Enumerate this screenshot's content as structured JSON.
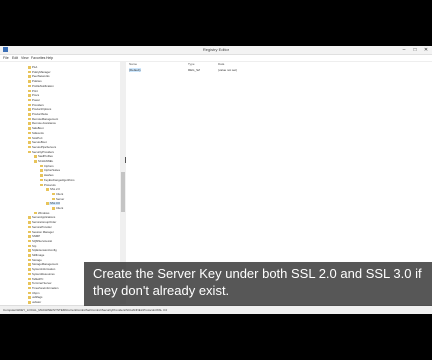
{
  "window": {
    "title": "Registry Editor",
    "controls": [
      "–",
      "□",
      "✕"
    ]
  },
  "menu": [
    "File",
    "Edit",
    "View",
    "Favorites",
    "Help"
  ],
  "tree": {
    "items": [
      "PLA",
      "PolicyManager",
      "PeerNetworks",
      "Policies",
      "ProfileNotification",
      "Print",
      "Procs",
      "Power",
      "Providers",
      "ProductOptions",
      "ProductSuite",
      "RemoteManagement",
      "Remote Assistance",
      "SafeBoot",
      "ScEvents",
      "ScsiPort",
      "SecureBoot",
      "SecurePipeServers",
      "SecurityProviders",
      "SaslProfiles",
      "SCHANNEL",
      "Ciphers",
      "CipherSuites",
      "Hashes",
      "KeyExchangeAlgorithms",
      "Protocols",
      "SSL 2.0",
      "Client",
      "Server",
      "SSL 3.0",
      "Client",
      "Windows",
      "ServerApplications",
      "ServiceGroupOrder",
      "ServiceProvider",
      "Session Manager",
      "SNMP",
      "SQMServiceList",
      "Srp",
      "SrpExtensionConfig",
      "StillImage",
      "Storage",
      "StorageManagement",
      "SystemInformation",
      "SystemResources",
      "TabletPC",
      "Terminal Server",
      "TimeZoneInformation",
      "Ubpm",
      "usbflags",
      "usbstor"
    ]
  },
  "list": {
    "columns": [
      "Name",
      "Type",
      "Data"
    ],
    "rows": [
      {
        "name": "(Default)",
        "type": "REG_SZ",
        "data": "(value not set)"
      }
    ]
  },
  "statusbar": "Computer\\HKEY_LOCAL_MACHINE\\SYSTEM\\CurrentControlSet\\Control\\SecurityProviders\\SCHANNEL\\Protocols\\SSL 3.0",
  "caption": "Create the Server Key under both SSL 2.0 and SSL 3.0 if they don't already exist."
}
